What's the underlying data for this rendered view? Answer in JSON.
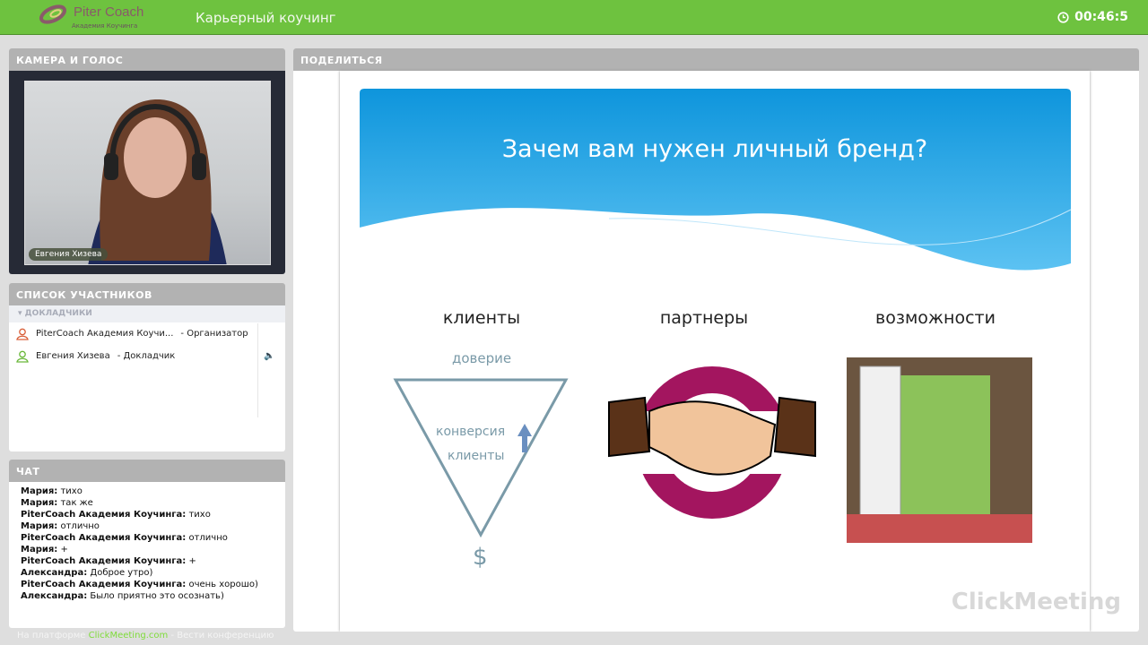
{
  "header": {
    "logo_main": "Piter Coach",
    "logo_sub": "Академия Коучинга",
    "title": "Карьерный коучинг",
    "timer": "00:46:5"
  },
  "camera": {
    "title": "КАМЕРА И ГОЛОС",
    "speaker_name": "Евгения Хизева"
  },
  "participants": {
    "title": "СПИСОК УЧАСТНИКОВ",
    "group": "ДОКЛАДЧИКИ",
    "items": [
      {
        "name": "PiterCoach Академия Коучи...",
        "role": "- Организатор",
        "color": "#d9603a"
      },
      {
        "name": "Евгения Хизева",
        "role": "- Докладчик",
        "color": "#6ab83a"
      }
    ]
  },
  "chat": {
    "title": "ЧАТ",
    "messages": [
      {
        "author": "Мария:",
        "text": "тихо"
      },
      {
        "author": "Мария:",
        "text": "так же"
      },
      {
        "author": "PiterCoach Академия Коучинга:",
        "text": "тихо"
      },
      {
        "author": "Мария:",
        "text": "отлично"
      },
      {
        "author": "PiterCoach Академия Коучинга:",
        "text": "отлично"
      },
      {
        "author": "Мария:",
        "text": "+"
      },
      {
        "author": "PiterCoach Академия Коучинга:",
        "text": "+"
      },
      {
        "author": "Александра:",
        "text": "Доброе утро)"
      },
      {
        "author": "PiterCoach Академия Коучинга:",
        "text": "очень хорошо)"
      },
      {
        "author": "Александра:",
        "text": "Было приятно это осознать)"
      }
    ]
  },
  "footer": {
    "prefix": "На платформе ",
    "link": "ClickMeeting.com",
    "suffix": " - Вести конференцию"
  },
  "share": {
    "title": "ПОДЕЛИТЬСЯ",
    "slide": {
      "title": "Зачем вам нужен личный бренд?",
      "col1": "клиенты",
      "col2": "партнеры",
      "col3": "возможности",
      "trust": "доверие",
      "conversion": "конверсия",
      "clients": "клиенты",
      "dollar": "$"
    },
    "watermark": "ClickMeeting"
  }
}
